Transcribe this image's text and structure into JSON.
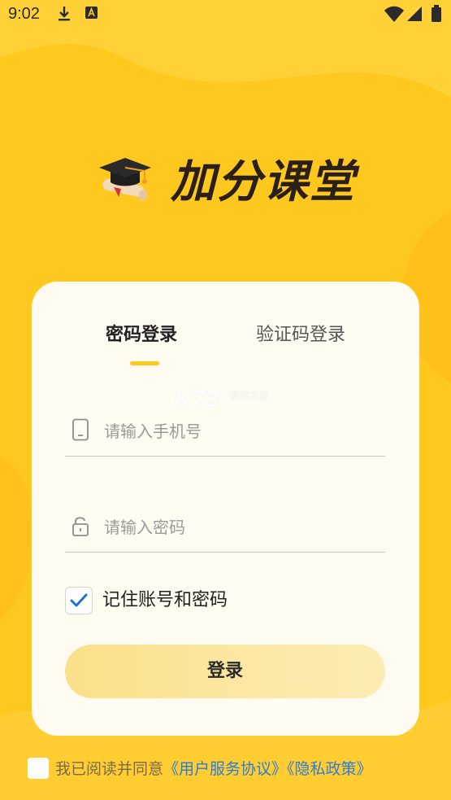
{
  "status_bar": {
    "time": "9:02",
    "icons": [
      "download-icon",
      "app-notification-icon",
      "wifi-icon",
      "signal-icon",
      "battery-icon"
    ]
  },
  "brand": {
    "title": "加分课堂",
    "logo_icon": "graduation-cap-icon"
  },
  "login": {
    "tabs": [
      {
        "label": "密码登录",
        "active": true
      },
      {
        "label": "验证码登录",
        "active": false
      }
    ],
    "phone": {
      "placeholder": "请输入手机号",
      "value": "",
      "icon": "phone-icon"
    },
    "password": {
      "placeholder": "请输入密码",
      "value": "",
      "icon": "lock-icon"
    },
    "remember": {
      "label": "记住账号和密码",
      "checked": true
    },
    "submit_label": "登录"
  },
  "watermark": {
    "big": "K73",
    "small": "游戏之家"
  },
  "agreement": {
    "checked": false,
    "prefix": "我已阅读并同意",
    "user_agreement": "《用户服务协议》",
    "privacy_policy": "《隐私政策》"
  },
  "colors": {
    "background": "#FFC81E",
    "card": "#FFFBF0",
    "accent": "#FFC81E",
    "link": "#2E7BD6",
    "check": "#1E6FD9"
  }
}
